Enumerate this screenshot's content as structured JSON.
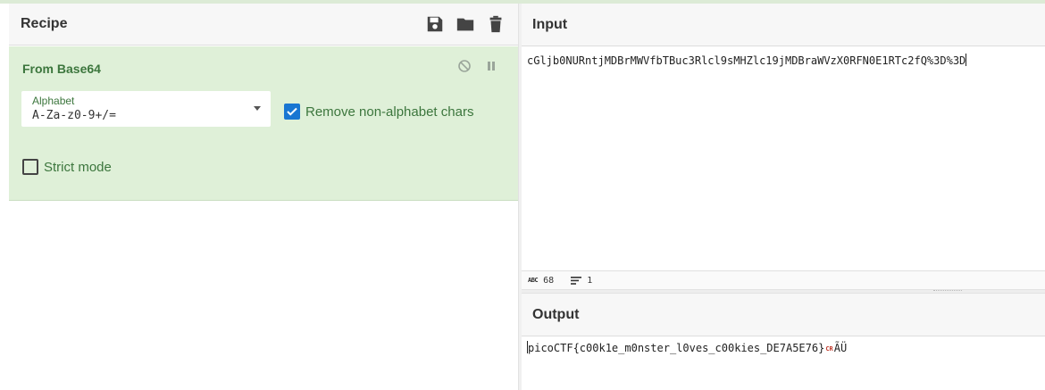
{
  "recipe": {
    "title": "Recipe",
    "icons": [
      "save-icon",
      "folder-icon",
      "trash-icon"
    ],
    "operation": {
      "name": "From Base64",
      "alphabet_label": "Alphabet",
      "alphabet_value": "A-Za-z0-9+/=",
      "remove_non_alphabet": {
        "label": "Remove non-alphabet chars",
        "checked": true
      },
      "strict_mode": {
        "label": "Strict mode",
        "checked": false
      }
    }
  },
  "input": {
    "title": "Input",
    "text": "cGljb0NURntjMDBrMWVfbTBuc3Rlcl9sMHZlc19jMDBraWVzX0RFN0E1RTc2fQ%3D%3D",
    "length": "68",
    "lines": "1"
  },
  "output": {
    "title": "Output",
    "text": "picoCTF{c00k1e_m0nster_l0ves_c00kies_DE7A5E76}",
    "cr_glyph": "CR",
    "trailing": "ÃÜ"
  },
  "colors": {
    "operation_bg": "#dff0d8",
    "operation_text": "#3c763d",
    "checkbox_blue": "#1976d2"
  }
}
